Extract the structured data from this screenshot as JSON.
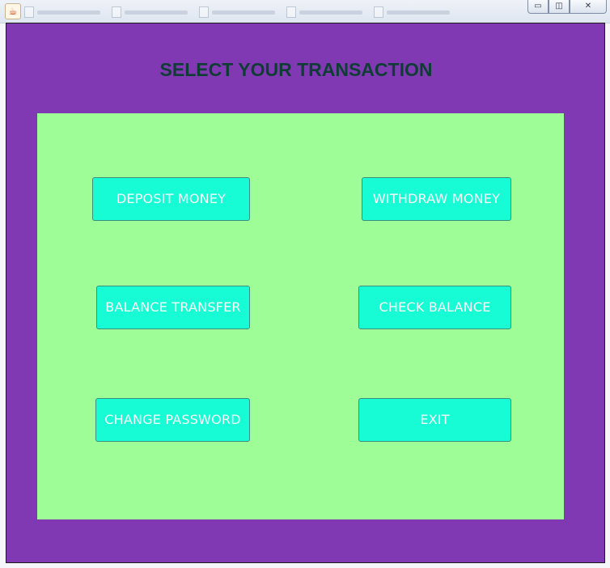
{
  "window": {
    "controls": {
      "minimize_glyph": "▭",
      "maximize_glyph": "◫",
      "close_glyph": "✕"
    }
  },
  "screen": {
    "heading": "SELECT YOUR TRANSACTION",
    "buttons": {
      "deposit": "DEPOSIT MONEY",
      "withdraw": "WITHDRAW MONEY",
      "balance_transfer": "BALANCE TRANSFER",
      "check_balance": "CHECK BALANCE",
      "change_password": "CHANGE PASSWORD",
      "exit": "EXIT"
    }
  },
  "colors": {
    "frame_background": "#8039b3",
    "panel_background": "#9efd97",
    "button_background": "#18fcd5",
    "heading_text": "#0f3d35",
    "button_text": "#f5fffd"
  },
  "icons": {
    "app": "java-coffee-cup-icon"
  }
}
